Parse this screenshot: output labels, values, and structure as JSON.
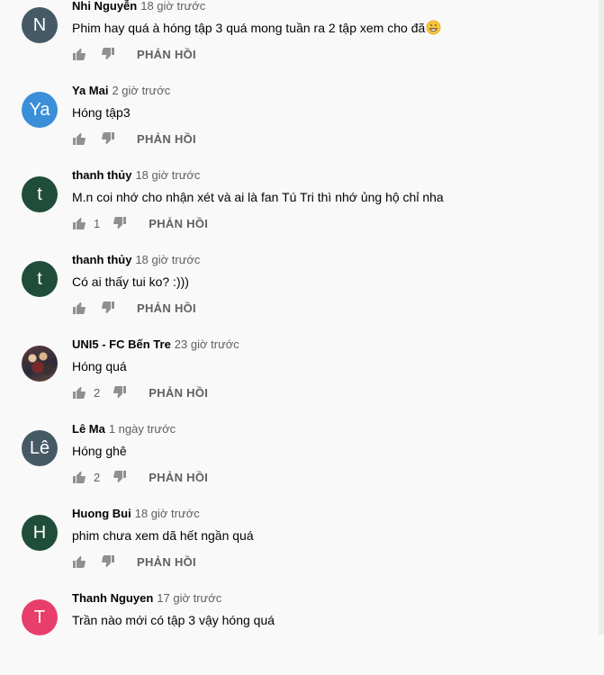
{
  "reply_label": "PHẢN HỒI",
  "comments": [
    {
      "avatar_letter": "N",
      "avatar_color": "#455a64",
      "author": "Nhi Nguyễn",
      "time": "18 giờ trước",
      "text": "Phim hay quá à hóng tập 3 quá mong tuần ra 2 tập xem cho đã",
      "emoji": "grinning-face-emoji",
      "likes": ""
    },
    {
      "avatar_letter": "Ya",
      "avatar_color": "#3a8fd8",
      "author": "Ya Mai",
      "time": "2 giờ trước",
      "text": "Hóng tập3",
      "likes": ""
    },
    {
      "avatar_letter": "t",
      "avatar_color": "#1f4d3a",
      "author": "thanh thủy",
      "time": "18 giờ trước",
      "text": "M.n coi nhớ cho nhận xét và ai là fan Tú Tri thì nhớ ủng hộ chỉ nha",
      "likes": "1"
    },
    {
      "avatar_letter": "t",
      "avatar_color": "#1f4d3a",
      "author": "thanh thủy",
      "time": "18 giờ trước",
      "text": "Có ai thấy tui ko? :)))",
      "likes": ""
    },
    {
      "avatar_letter": "",
      "avatar_color": "#3b3030",
      "author": "UNI5 - FC Bến Tre",
      "time": "23 giờ trước",
      "text": "Hóng quá",
      "likes": "2"
    },
    {
      "avatar_letter": "Lê",
      "avatar_color": "#455a64",
      "author": "Lê Ma",
      "time": "1 ngày trước",
      "text": "Hóng ghê",
      "likes": "2"
    },
    {
      "avatar_letter": "H",
      "avatar_color": "#1f4d3a",
      "author": "Huong Bui",
      "time": "18 giờ trước",
      "text": "phim chưa xem dã hết ngần quá",
      "likes": ""
    },
    {
      "avatar_letter": "T",
      "avatar_color": "#e83e6c",
      "author": "Thanh Nguyen",
      "time": "17 giờ trước",
      "text": "Trần nào mới có tập 3 vậy hóng quá",
      "likes": ""
    }
  ]
}
